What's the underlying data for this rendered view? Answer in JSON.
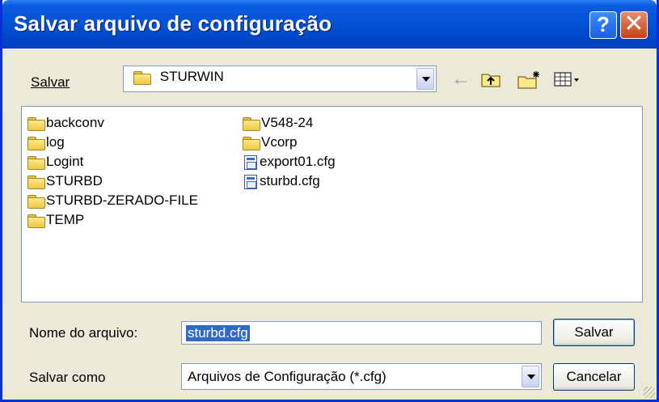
{
  "window": {
    "title": "Salvar arquivo de configuração",
    "help_label": "?",
    "close_label": "✕"
  },
  "save_in": {
    "label": "Salvar",
    "folder": "STURWIN"
  },
  "toolbar": {
    "back_icon": "back-arrow-icon",
    "up_icon": "up-folder-icon",
    "new_folder_icon": "new-folder-icon",
    "view_icon": "view-menu-icon"
  },
  "files": {
    "col1": [
      {
        "name": "backconv",
        "type": "folder"
      },
      {
        "name": "log",
        "type": "folder"
      },
      {
        "name": "Logint",
        "type": "folder"
      },
      {
        "name": "STURBD",
        "type": "folder"
      },
      {
        "name": "STURBD-ZERADO-FILE",
        "type": "folder"
      },
      {
        "name": "TEMP",
        "type": "folder"
      }
    ],
    "col2": [
      {
        "name": "V548-24",
        "type": "folder"
      },
      {
        "name": "Vcorp",
        "type": "folder"
      },
      {
        "name": "export01.cfg",
        "type": "file"
      },
      {
        "name": "sturbd.cfg",
        "type": "file"
      }
    ]
  },
  "filename": {
    "label": "Nome do arquivo:",
    "value": "sturbd.cfg"
  },
  "filetype": {
    "label": "Salvar como",
    "value": "Arquivos de Configuração (*.cfg)"
  },
  "buttons": {
    "save": "Salvar",
    "cancel": "Cancelar"
  },
  "colors": {
    "title_bar": "#0054e3",
    "dialog_bg": "#ece9d8",
    "selection": "#316ac5"
  }
}
